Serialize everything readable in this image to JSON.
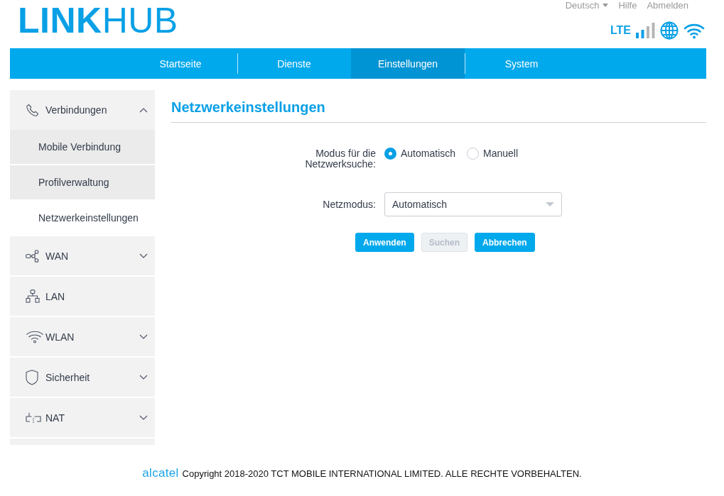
{
  "header": {
    "logo": "**LINK**HUB",
    "top_links": [
      {
        "label": "Deutsch",
        "kind": "dropdown"
      },
      {
        "label": "Hilfe",
        "kind": "link"
      },
      {
        "label": "Abmelden",
        "kind": "link"
      }
    ],
    "network_type": "LTE"
  },
  "nav": {
    "tabs": [
      {
        "label": "Startseite",
        "selected": false
      },
      {
        "label": "Dienste",
        "selected": false
      },
      {
        "label": "Einstellungen",
        "selected": true
      },
      {
        "label": "System",
        "selected": false
      }
    ]
  },
  "sidebar": {
    "items": [
      {
        "label": "Verbindungen",
        "kind": "group",
        "expanded": true,
        "children": [
          {
            "label": "Mobile Verbindung",
            "selected": false
          },
          {
            "label": "Profilverwaltung",
            "selected": false
          },
          {
            "label": "Netzwerkeinstellungen",
            "selected": true
          }
        ]
      },
      {
        "label": "WAN",
        "kind": "group",
        "expanded": false
      },
      {
        "label": "LAN",
        "kind": "link"
      },
      {
        "label": "WLAN",
        "kind": "group",
        "expanded": false
      },
      {
        "label": "Sicherheit",
        "kind": "group",
        "expanded": false
      },
      {
        "label": "NAT",
        "kind": "group",
        "expanded": false
      }
    ]
  },
  "content": {
    "title": "Netzwerkeinstellungen",
    "fields": [
      {
        "kind": "radio",
        "label": "Modus für die Netzwerksuche:",
        "options": [
          {
            "label": "Automatisch",
            "selected": true
          },
          {
            "label": "Manuell",
            "selected": false
          }
        ]
      },
      {
        "kind": "select",
        "label": "Netzmodus:",
        "value": "Automatisch"
      }
    ],
    "buttons": [
      {
        "label": "Anwenden",
        "disabled": false
      },
      {
        "label": "Suchen",
        "disabled": true
      },
      {
        "label": "Abbrechen",
        "disabled": false
      }
    ]
  },
  "footer": {
    "brand": "alcatel",
    "copyright": "Copyright 2018-2020 TCT MOBILE INTERNATIONAL LIMITED. ALLE RECHTE VORBEHALTEN."
  }
}
